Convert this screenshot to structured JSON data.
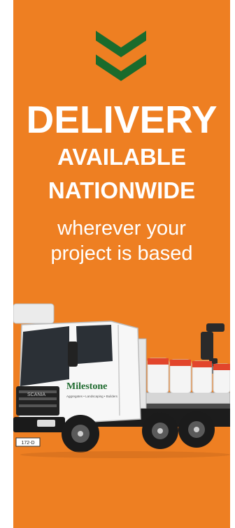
{
  "banner": {
    "headline": "DELIVERY",
    "line2": "AVAILABLE",
    "line3": "NATIONWIDE",
    "sub1": "wherever your",
    "sub2": "project is based"
  },
  "truck": {
    "brand": "Milestone",
    "tagline": "Aggregates • Landscaping • Builders",
    "cab_badge": "SCANIA"
  },
  "colors": {
    "background": "#ee7f22",
    "chevron": "#1a6b2c",
    "text": "#ffffff"
  },
  "icons": [
    "double-chevron-down-icon"
  ]
}
